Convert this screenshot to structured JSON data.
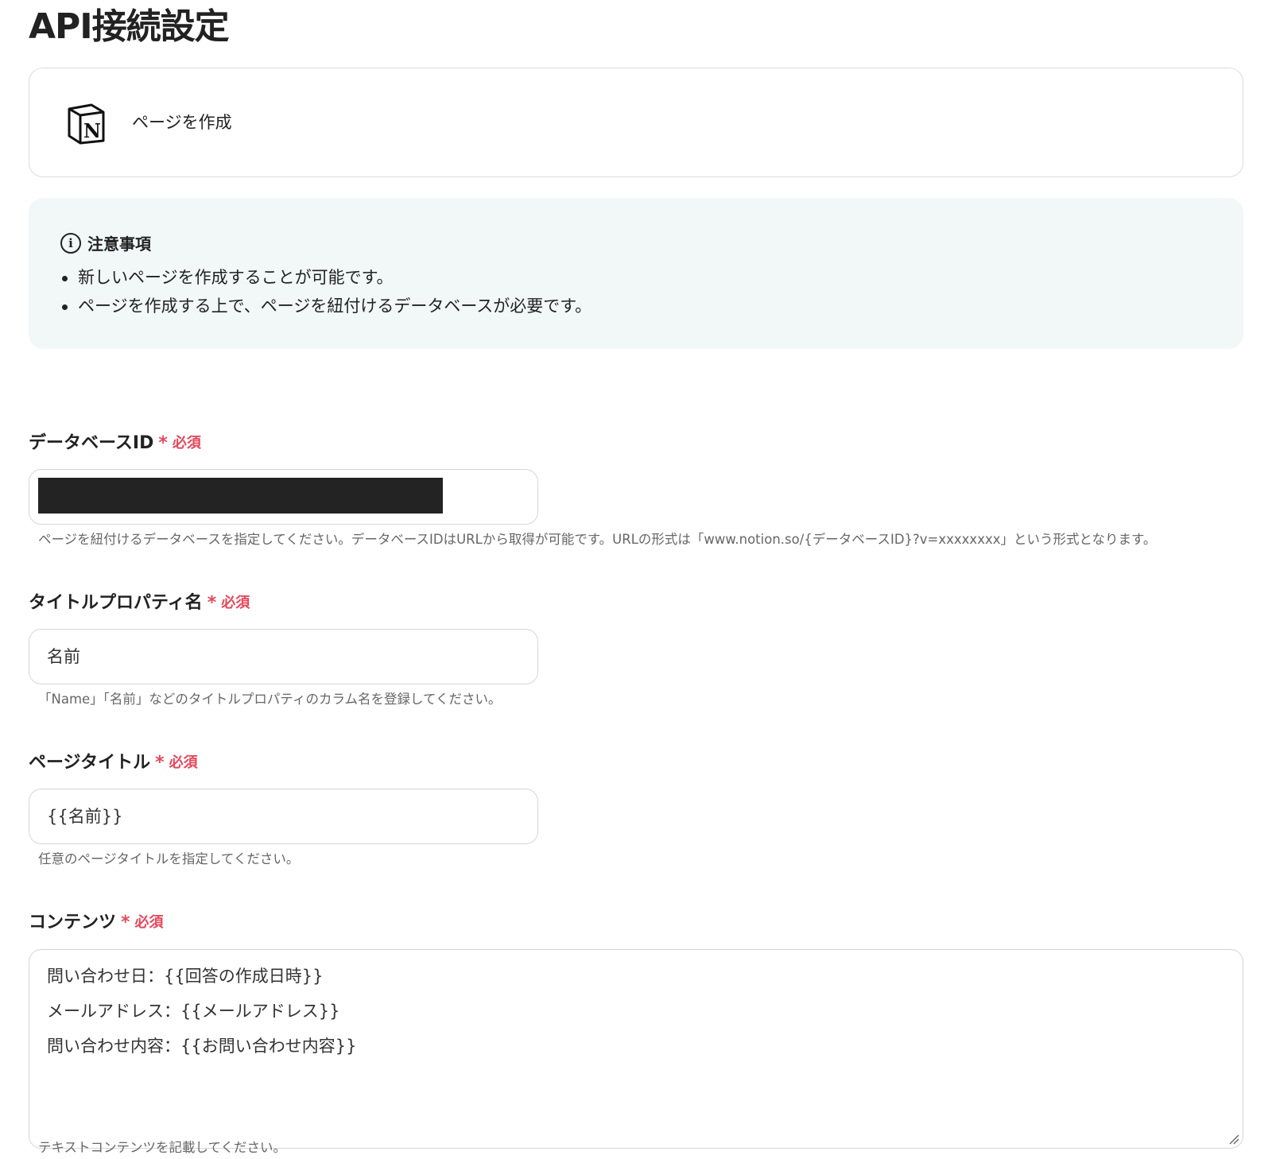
{
  "page": {
    "title": "API接続設定"
  },
  "action": {
    "label": "ページを作成",
    "icon": "notion-logo-icon"
  },
  "notice": {
    "title": "注意事項",
    "items": [
      "新しいページを作成することが可能です。",
      "ページを作成する上で、ページを紐付けるデータベースが必要です。"
    ]
  },
  "fields": {
    "database_id": {
      "label": "データベースID",
      "required_star": "*",
      "required_text": "必須",
      "value": "",
      "help": "ページを紐付けるデータベースを指定してください。データベースIDはURLから取得が可能です。URLの形式は「www.notion.so/{データベースID}?v=xxxxxxxx」という形式となります。"
    },
    "title_property": {
      "label": "タイトルプロパティ名",
      "required_star": "*",
      "required_text": "必須",
      "value": "名前",
      "help": "「Name」「名前」などのタイトルプロパティのカラム名を登録してください。"
    },
    "page_title": {
      "label": "ページタイトル",
      "required_star": "*",
      "required_text": "必須",
      "value": "{{名前}}",
      "help": "任意のページタイトルを指定してください。"
    },
    "contents": {
      "label": "コンテンツ",
      "required_star": "*",
      "required_text": "必須",
      "lines": [
        "問い合わせ日：{{回答の作成日時}}",
        "メールアドレス：{{メールアドレス}}",
        "問い合わせ内容：{{お問い合わせ内容}}"
      ],
      "help": "テキストコンテンツを記載してください。"
    }
  },
  "colors": {
    "required": "#e5485c",
    "notice_bg": "#f2f8f8",
    "border": "#d6d6d6"
  }
}
